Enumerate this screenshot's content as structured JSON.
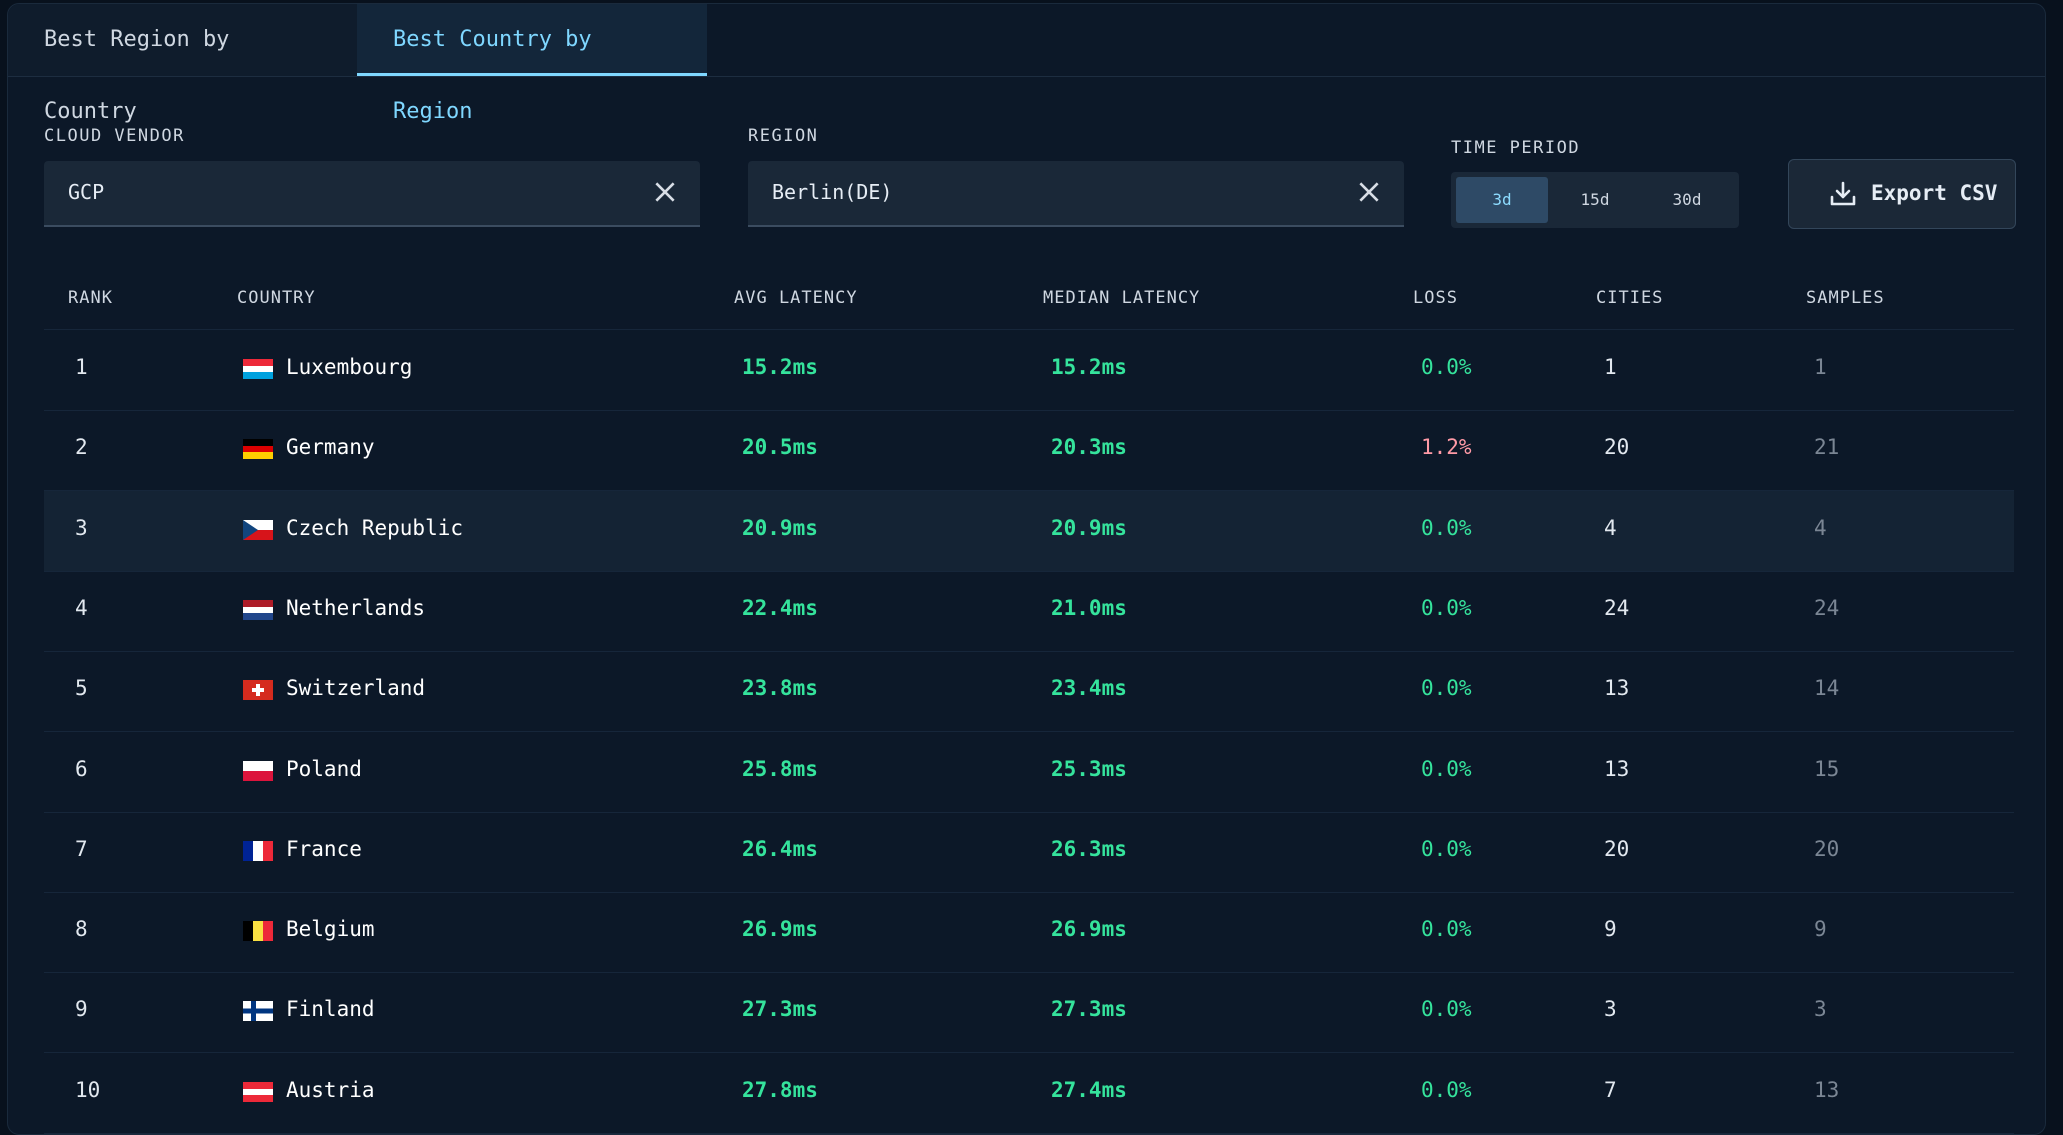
{
  "tabs": [
    {
      "label": "Best Region by Country",
      "active": false
    },
    {
      "label": "Best Country by Region",
      "active": true
    }
  ],
  "filters": {
    "cloud_vendor_label": "CLOUD VENDOR",
    "cloud_vendor_value": "GCP",
    "region_label": "REGION",
    "region_value": "Berlin(DE)",
    "time_period_label": "TIME PERIOD",
    "time_periods": [
      "3d",
      "15d",
      "30d"
    ],
    "time_period_selected": "3d",
    "export_label": "Export CSV"
  },
  "table": {
    "headers": {
      "rank": "RANK",
      "country": "COUNTRY",
      "avg": "AVG LATENCY",
      "median": "MEDIAN LATENCY",
      "loss": "LOSS",
      "cities": "CITIES",
      "samples": "SAMPLES"
    },
    "rows": [
      {
        "rank": "1",
        "country": "Luxembourg",
        "flag": "lu",
        "avg": "15.2ms",
        "median": "15.2ms",
        "loss": "0.0%",
        "cities": "1",
        "samples": "1"
      },
      {
        "rank": "2",
        "country": "Germany",
        "flag": "de",
        "avg": "20.5ms",
        "median": "20.3ms",
        "loss": "1.2%",
        "cities": "20",
        "samples": "21"
      },
      {
        "rank": "3",
        "country": "Czech Republic",
        "flag": "cz",
        "avg": "20.9ms",
        "median": "20.9ms",
        "loss": "0.0%",
        "cities": "4",
        "samples": "4"
      },
      {
        "rank": "4",
        "country": "Netherlands",
        "flag": "nl",
        "avg": "22.4ms",
        "median": "21.0ms",
        "loss": "0.0%",
        "cities": "24",
        "samples": "24"
      },
      {
        "rank": "5",
        "country": "Switzerland",
        "flag": "ch",
        "avg": "23.8ms",
        "median": "23.4ms",
        "loss": "0.0%",
        "cities": "13",
        "samples": "14"
      },
      {
        "rank": "6",
        "country": "Poland",
        "flag": "pl",
        "avg": "25.8ms",
        "median": "25.3ms",
        "loss": "0.0%",
        "cities": "13",
        "samples": "15"
      },
      {
        "rank": "7",
        "country": "France",
        "flag": "fr",
        "avg": "26.4ms",
        "median": "26.3ms",
        "loss": "0.0%",
        "cities": "20",
        "samples": "20"
      },
      {
        "rank": "8",
        "country": "Belgium",
        "flag": "be",
        "avg": "26.9ms",
        "median": "26.9ms",
        "loss": "0.0%",
        "cities": "9",
        "samples": "9"
      },
      {
        "rank": "9",
        "country": "Finland",
        "flag": "fi",
        "avg": "27.3ms",
        "median": "27.3ms",
        "loss": "0.0%",
        "cities": "3",
        "samples": "3"
      },
      {
        "rank": "10",
        "country": "Austria",
        "flag": "at",
        "avg": "27.8ms",
        "median": "27.4ms",
        "loss": "0.0%",
        "cities": "7",
        "samples": "13"
      }
    ]
  },
  "colors": {
    "latency_good": "#35e39c",
    "loss_bad": "#ff9aa6",
    "tab_active": "#7fd7ff"
  }
}
